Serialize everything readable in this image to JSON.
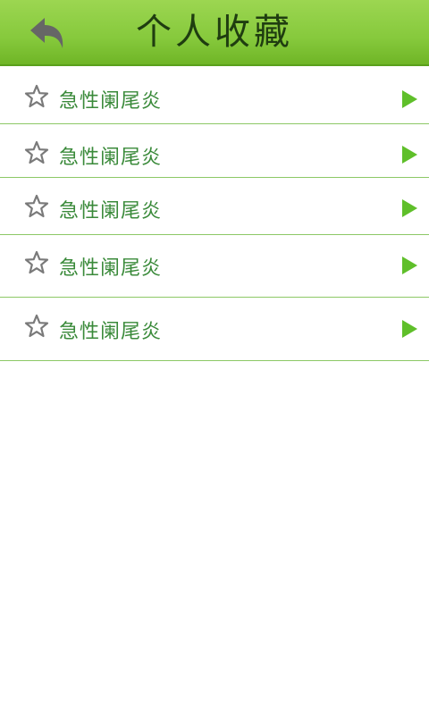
{
  "header": {
    "title": "个人收藏",
    "back_icon": "back-arrow-icon"
  },
  "list": {
    "items": [
      {
        "label": "急性阑尾炎",
        "icon": "star-outline-icon",
        "chevron": "play-arrow-icon"
      },
      {
        "label": "急性阑尾炎",
        "icon": "star-outline-icon",
        "chevron": "play-arrow-icon"
      },
      {
        "label": "急性阑尾炎",
        "icon": "star-outline-icon",
        "chevron": "play-arrow-icon"
      },
      {
        "label": "急性阑尾炎",
        "icon": "star-outline-icon",
        "chevron": "play-arrow-icon"
      },
      {
        "label": "急性阑尾炎",
        "icon": "star-outline-icon",
        "chevron": "play-arrow-icon"
      }
    ]
  },
  "colors": {
    "header_green": "#86c93c",
    "text_green": "#3a8a3a",
    "divider": "#8cc866",
    "arrow_green": "#5fbf2a"
  }
}
